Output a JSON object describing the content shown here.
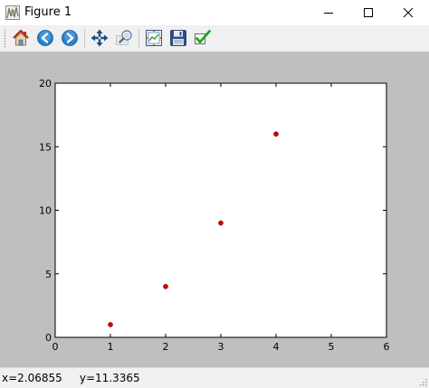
{
  "window": {
    "title": "Figure 1"
  },
  "toolbar": {
    "buttons": [
      {
        "name": "home-button",
        "icon": "home-icon"
      },
      {
        "name": "back-button",
        "icon": "arrow-left-icon"
      },
      {
        "name": "forward-button",
        "icon": "arrow-right-icon"
      },
      {
        "name": "pan-button",
        "icon": "move-icon"
      },
      {
        "name": "zoom-button",
        "icon": "zoom-rect-icon"
      },
      {
        "name": "subplots-button",
        "icon": "subplots-icon"
      },
      {
        "name": "save-button",
        "icon": "floppy-disk-icon"
      },
      {
        "name": "edit-axes-button",
        "icon": "checkmark-icon"
      }
    ]
  },
  "status": {
    "text": "x=2.06855     y=11.3365"
  },
  "colors": {
    "canvas_bg": "#bfbfbf",
    "point": "#cc0000",
    "axes_bg": "#ffffff"
  },
  "chart_data": {
    "type": "scatter",
    "title": "",
    "xlabel": "",
    "ylabel": "",
    "x": [
      1,
      2,
      3,
      4
    ],
    "y": [
      1,
      4,
      9,
      16
    ],
    "xlim": [
      0,
      6
    ],
    "ylim": [
      0,
      20
    ],
    "xticks": [
      "0",
      "1",
      "2",
      "3",
      "4",
      "5",
      "6"
    ],
    "yticks": [
      "0",
      "5",
      "10",
      "15",
      "20"
    ],
    "grid": false,
    "marker_color": "#cc0000"
  }
}
